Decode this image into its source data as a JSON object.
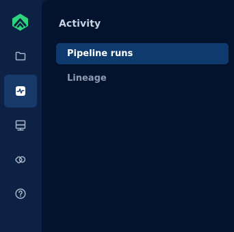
{
  "colors": {
    "rail_background": "#0d2145",
    "panel_background": "#03132e",
    "active_rail_background": "#173a6b",
    "active_item_background": "#0f3a6e",
    "logo_green": "#2ed47a",
    "icon_color": "#a8b4c8"
  },
  "rail": {
    "items": [
      {
        "icon": "folder-icon",
        "active": false
      },
      {
        "icon": "activity-icon",
        "active": true
      },
      {
        "icon": "server-icon",
        "active": false
      },
      {
        "icon": "connections-icon",
        "active": false
      },
      {
        "icon": "help-icon",
        "active": false
      }
    ]
  },
  "panel": {
    "title": "Activity",
    "items": [
      {
        "label": "Pipeline runs",
        "active": true
      },
      {
        "label": "Lineage",
        "active": false
      }
    ]
  }
}
